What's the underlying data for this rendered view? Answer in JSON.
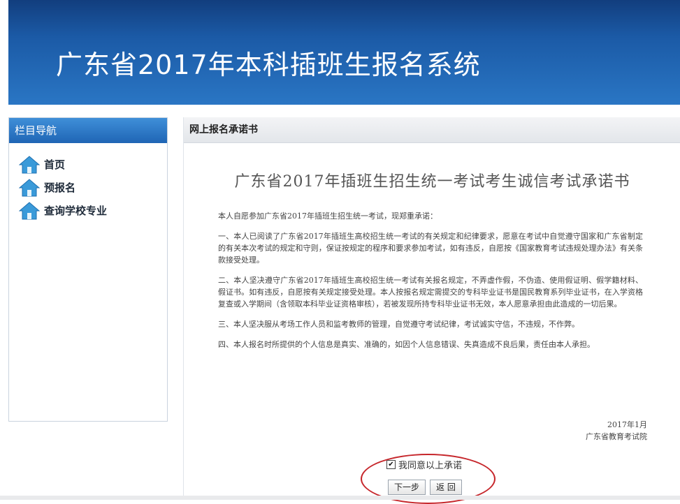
{
  "banner": {
    "title": "广东省2017年本科插班生报名系统"
  },
  "sidebar": {
    "header": "栏目导航",
    "items": [
      {
        "label": "首页",
        "icon": "home-icon"
      },
      {
        "label": "预报名",
        "icon": "home-icon"
      },
      {
        "label": "查询学校专业",
        "icon": "home-icon"
      }
    ]
  },
  "main": {
    "header": "网上报名承诺书",
    "doc_title": "广东省2017年插班生招生统一考试考生诚信考试承诺书",
    "paragraphs": [
      "本人自愿参加广东省2017年插班生招生统一考试，现郑重承诺：",
      "一、本人已阅读了广东省2017年插班生高校招生统一考试的有关规定和纪律要求，愿意在考试中自觉遵守国家和广东省制定的有关本次考试的规定和守则，保证按规定的程序和要求参加考试，如有违反，自愿按《国家教育考试违规处理办法》有关条款接受处理。",
      "二、本人坚决遵守广东省2017年插班生高校招生统一考试有关报名规定，不弄虚作假，不伪造、使用假证明、假学籍材料、假证书。如有违反，自愿按有关规定接受处理。本人按报名规定需提交的专科毕业证书是国民教育系列毕业证书，在入学资格复查或入学期间（含领取本科毕业证资格审核），若被发现所持专科毕业证书无效，本人愿意承担由此造成的一切后果。",
      "三、本人坚决服从考场工作人员和监考教师的管理，自觉遵守考试纪律，考试诚实守信，不违规，不作弊。",
      "四、本人报名时所提供的个人信息是真实、准确的，如因个人信息错误、失真造成不良后果，责任由本人承担。"
    ],
    "date": "2017年1月",
    "org": "广东省教育考试院",
    "agree_label": "我同意以上承诺",
    "agree_checked": true,
    "next_label": "下一步",
    "back_label": "返 回"
  },
  "colors": {
    "banner_accent": "#1b5aa6",
    "sidebar_header": "#2a75c4",
    "highlight_ellipse": "#c6262b"
  }
}
